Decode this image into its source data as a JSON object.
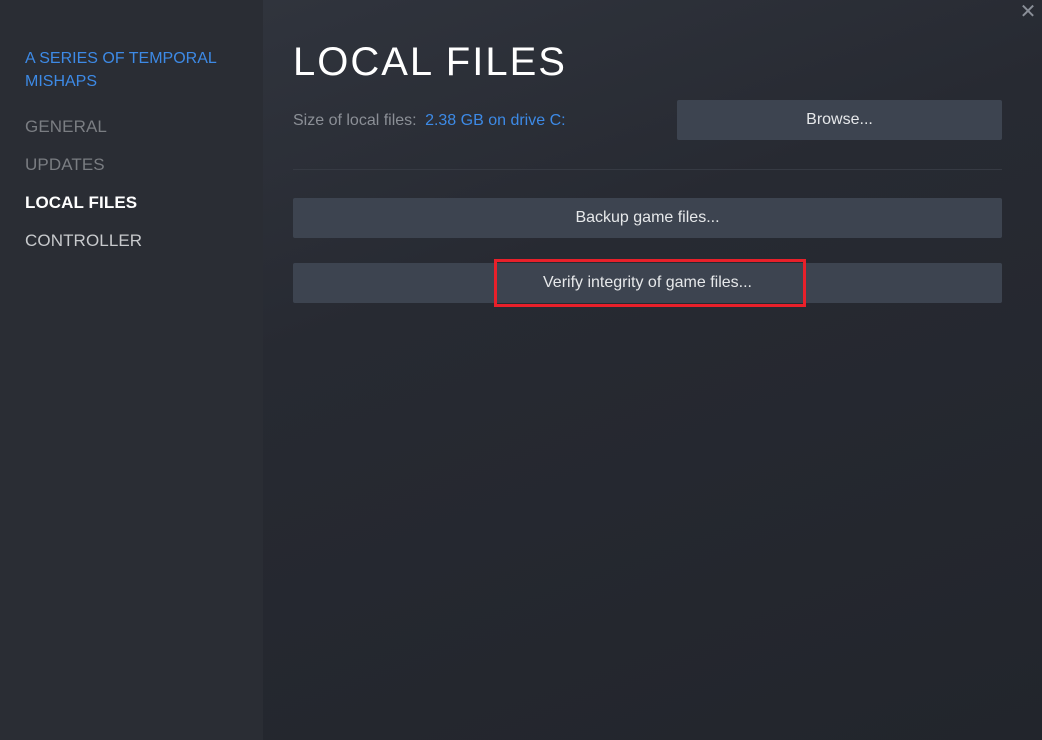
{
  "sidebar": {
    "game_title": "A SERIES OF TEMPORAL MISHAPS",
    "items": [
      {
        "label": "GENERAL",
        "state": "dim"
      },
      {
        "label": "UPDATES",
        "state": "dim"
      },
      {
        "label": "LOCAL FILES",
        "state": "active"
      },
      {
        "label": "CONTROLLER",
        "state": "normal"
      }
    ]
  },
  "window": {
    "close_icon": "close-x-icon",
    "close_glyph": "✕"
  },
  "main": {
    "title": "LOCAL FILES",
    "size_label": "Size of local files:",
    "size_value": "2.38 GB on drive C:",
    "browse_label": "Browse...",
    "backup_label": "Backup game files...",
    "verify_label": "Verify integrity of game files..."
  },
  "colors": {
    "accent_blue": "#3d8ae6",
    "highlight_red": "#e8202a",
    "button_bg": "#3d4450"
  }
}
